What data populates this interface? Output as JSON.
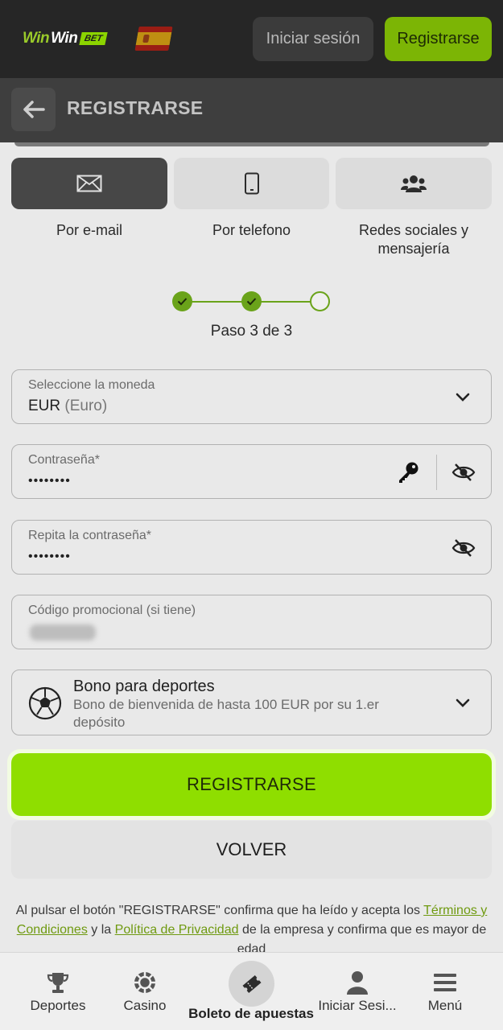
{
  "header": {
    "logo_part1": "Win",
    "logo_part2": "Win",
    "logo_part3": "BET",
    "login_label": "Iniciar sesión",
    "register_label": "Registrarse"
  },
  "titlebar": {
    "title": "REGISTRARSE"
  },
  "tabs": [
    {
      "label": "Por e-mail",
      "icon": "envelope-icon",
      "active": true
    },
    {
      "label": "Por telefono",
      "icon": "phone-icon",
      "active": false
    },
    {
      "label": "Redes sociales y mensajería",
      "icon": "users-icon",
      "active": false
    }
  ],
  "steps": {
    "text": "Paso 3 de 3",
    "completed": 2,
    "total": 3
  },
  "form": {
    "currency": {
      "label": "Seleccione la moneda",
      "code": "EUR",
      "name": "(Euro)"
    },
    "password": {
      "label": "Contraseña*",
      "value": "••••••••"
    },
    "password_repeat": {
      "label": "Repita la contraseña*",
      "value": "••••••••"
    },
    "promo": {
      "label": "Código promocional (si tiene)"
    },
    "bonus": {
      "title": "Bono para deportes",
      "description": "Bono de bienvenida de hasta 100 EUR por su 1.er depósito"
    }
  },
  "actions": {
    "register_label": "REGISTRARSE",
    "back_label": "VOLVER"
  },
  "terms": {
    "part1": "Al pulsar el botón \"REGISTRARSE\" confirma que ha leído y acepta los",
    "link1": "Términos y Condiciones",
    "part2": "y la",
    "link2": "Política de Privacidad",
    "part3": "de la empresa y confirma que es mayor de edad"
  },
  "bottom_nav": [
    {
      "label": "Deportes",
      "icon": "trophy-icon"
    },
    {
      "label": "Casino",
      "icon": "casino-chip-icon"
    },
    {
      "label": "Boleto de apuestas",
      "icon": "ticket-icon"
    },
    {
      "label": "Iniciar Sesi...",
      "icon": "user-icon"
    },
    {
      "label": "Menú",
      "icon": "menu-icon"
    }
  ],
  "colors": {
    "accent": "#8fde00",
    "header_bg": "#262626",
    "step_green": "#6aa31a"
  }
}
